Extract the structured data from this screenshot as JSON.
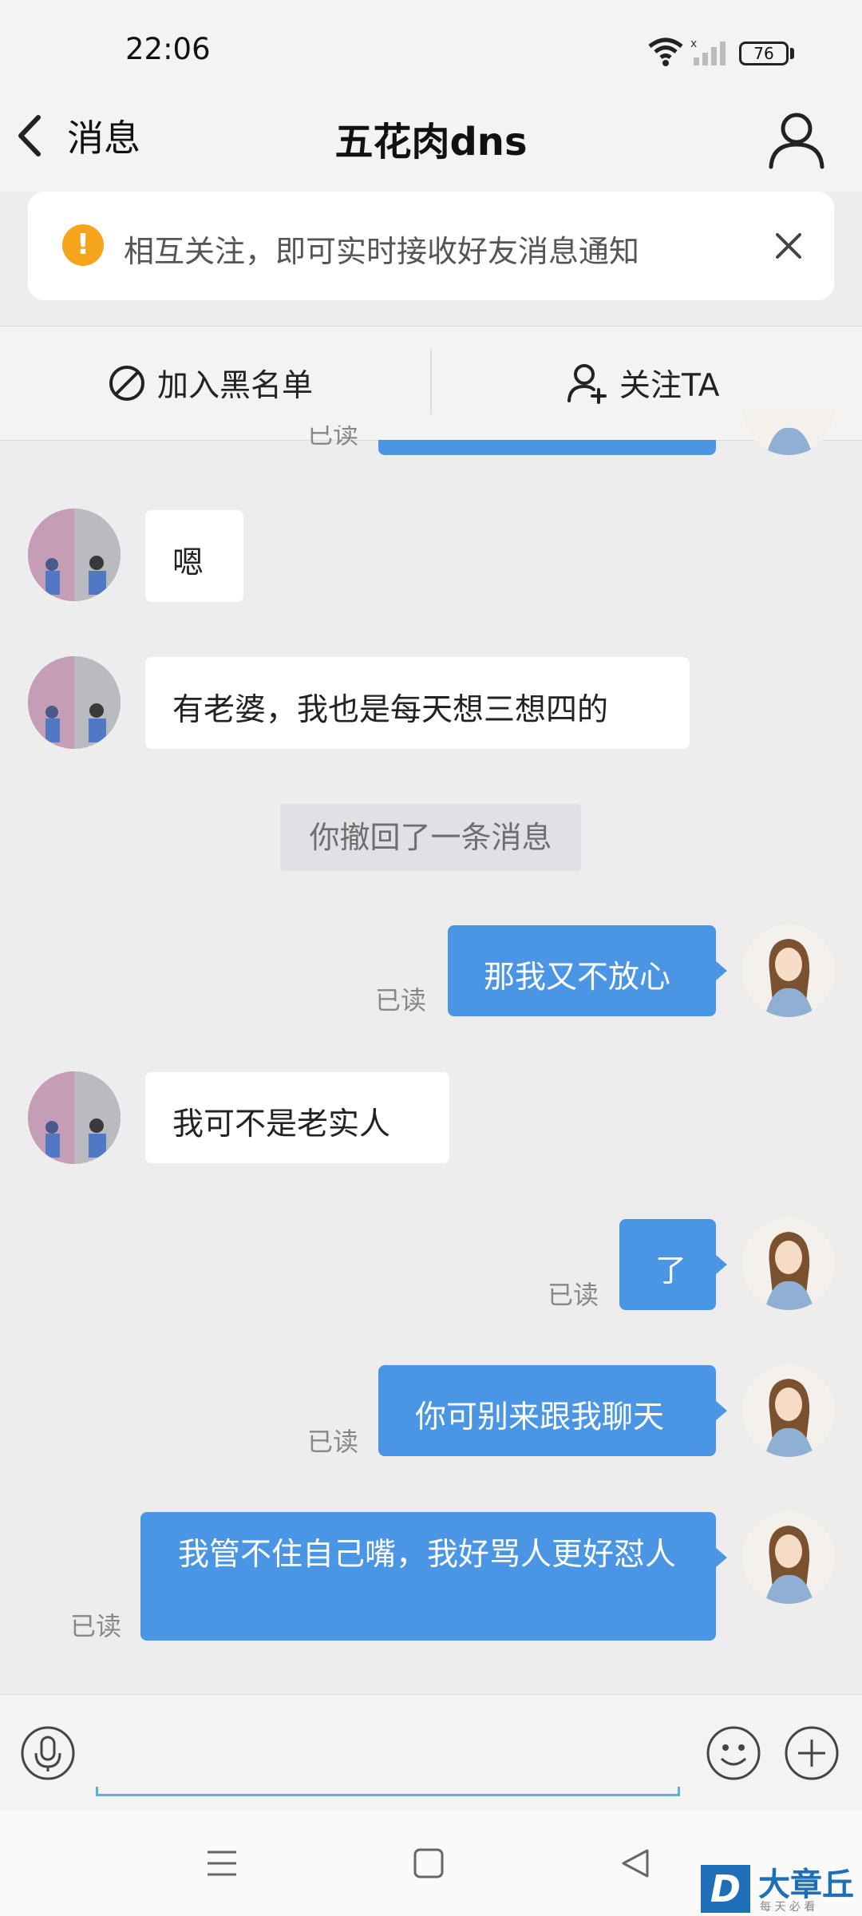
{
  "status_bar": {
    "time": "22:06",
    "battery": "76"
  },
  "header": {
    "back_label": "消息",
    "title": "五花肉dns"
  },
  "notice": {
    "text": "相互关注，即可实时接收好友消息通知"
  },
  "actions": {
    "blacklist_label": "加入黑名单",
    "follow_label": "关注TA"
  },
  "messages": [
    {
      "side": "right",
      "text": "",
      "read_label": "已读",
      "partial": true
    },
    {
      "side": "left",
      "text": "嗯"
    },
    {
      "side": "left",
      "text": "有老婆，我也是每天想三想四的"
    },
    {
      "side": "system",
      "text": "你撤回了一条消息"
    },
    {
      "side": "right",
      "text": "那我又不放心",
      "read_label": "已读"
    },
    {
      "side": "left",
      "text": "我可不是老实人"
    },
    {
      "side": "right",
      "text": "了",
      "read_label": "已读"
    },
    {
      "side": "right",
      "text": "你可别来跟我聊天",
      "read_label": "已读"
    },
    {
      "side": "right",
      "text": "我管不住自己嘴，我好骂人更好怼人",
      "read_label": "已读"
    }
  ],
  "watermark": {
    "brand": "大章丘",
    "slogan": "每 天 必 看"
  },
  "colors": {
    "bubble_right": "#4a96e4",
    "warning": "#f6a41c",
    "background": "#ededed"
  }
}
